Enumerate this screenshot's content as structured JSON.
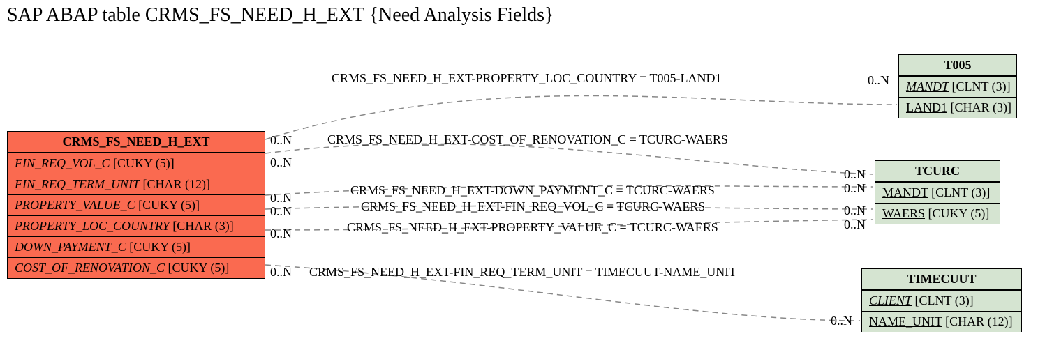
{
  "title": "SAP ABAP table CRMS_FS_NEED_H_EXT {Need Analysis Fields}",
  "main_table": {
    "name": "CRMS_FS_NEED_H_EXT",
    "fields": [
      {
        "name": "FIN_REQ_VOL_C",
        "type": "[CUKY (5)]"
      },
      {
        "name": "FIN_REQ_TERM_UNIT",
        "type": "[CHAR (12)]"
      },
      {
        "name": "PROPERTY_VALUE_C",
        "type": "[CUKY (5)]"
      },
      {
        "name": "PROPERTY_LOC_COUNTRY",
        "type": "[CHAR (3)]"
      },
      {
        "name": "DOWN_PAYMENT_C",
        "type": "[CUKY (5)]"
      },
      {
        "name": "COST_OF_RENOVATION_C",
        "type": "[CUKY (5)]"
      }
    ]
  },
  "ref_tables": {
    "t005": {
      "name": "T005",
      "fields": [
        {
          "name": "MANDT",
          "type": "[CLNT (3)]",
          "ital": true,
          "ul": true
        },
        {
          "name": "LAND1",
          "type": "[CHAR (3)]",
          "ital": false,
          "ul": true
        }
      ]
    },
    "tcurc": {
      "name": "TCURC",
      "fields": [
        {
          "name": "MANDT",
          "type": "[CLNT (3)]",
          "ital": false,
          "ul": true
        },
        {
          "name": "WAERS",
          "type": "[CUKY (5)]",
          "ital": false,
          "ul": true
        }
      ]
    },
    "timecuut": {
      "name": "TIMECUUT",
      "fields": [
        {
          "name": "CLIENT",
          "type": "[CLNT (3)]",
          "ital": true,
          "ul": true
        },
        {
          "name": "NAME_UNIT",
          "type": "[CHAR (12)]",
          "ital": false,
          "ul": true
        }
      ]
    }
  },
  "relations": [
    {
      "label": "CRMS_FS_NEED_H_EXT-PROPERTY_LOC_COUNTRY = T005-LAND1",
      "left_card": "0..N",
      "right_card": "0..N"
    },
    {
      "label": "CRMS_FS_NEED_H_EXT-COST_OF_RENOVATION_C = TCURC-WAERS",
      "left_card": "0..N",
      "right_card": "0..N"
    },
    {
      "label": "CRMS_FS_NEED_H_EXT-DOWN_PAYMENT_C = TCURC-WAERS",
      "left_card": "0..N",
      "right_card": "0..N"
    },
    {
      "label": "CRMS_FS_NEED_H_EXT-FIN_REQ_VOL_C = TCURC-WAERS",
      "left_card": "0..N",
      "right_card": "0..N"
    },
    {
      "label": "CRMS_FS_NEED_H_EXT-PROPERTY_VALUE_C = TCURC-WAERS",
      "left_card": "0..N",
      "right_card": "0..N"
    },
    {
      "label": "CRMS_FS_NEED_H_EXT-FIN_REQ_TERM_UNIT = TIMECUUT-NAME_UNIT",
      "left_card": "0..N",
      "right_card": "0..N"
    }
  ]
}
